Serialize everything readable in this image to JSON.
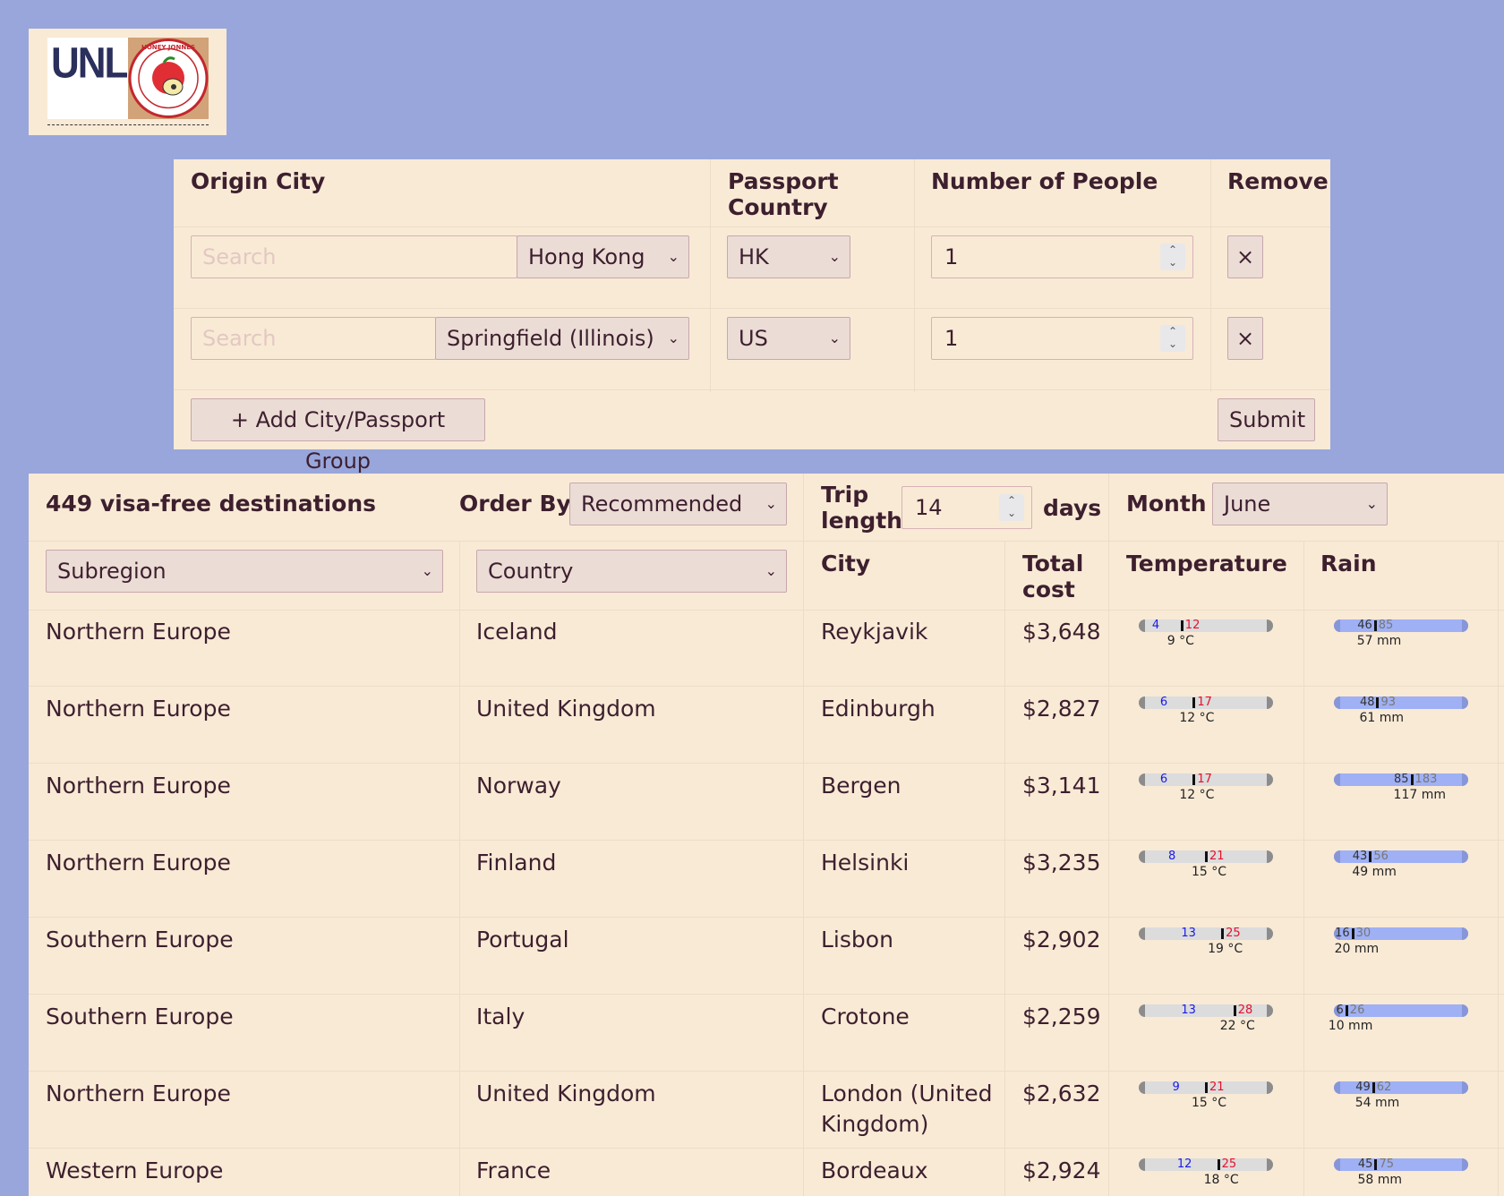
{
  "logo": {
    "text": "UNLI",
    "badge_text": "HONEY JONNES"
  },
  "form": {
    "headers": {
      "origin_city": "Origin City",
      "passport_country": "Passport Country",
      "num_people": "Number of People",
      "remove": "Remove"
    },
    "rows": [
      {
        "search_placeholder": "Search",
        "city": "Hong Kong",
        "passport": "HK",
        "people": "1",
        "remove_icon": "×"
      },
      {
        "search_placeholder": "Search",
        "city": "Springfield (Illinois)",
        "passport": "US",
        "people": "1",
        "remove_icon": "×"
      }
    ],
    "add_label": "+ Add City/Passport Group",
    "submit_label": "Submit"
  },
  "results": {
    "count_label": "449 visa-free destinations",
    "order_by_label": "Order By",
    "order_by_value": "Recommended",
    "trip_length_label": "Trip length",
    "trip_length_value": "14",
    "days_label": "days",
    "month_label": "Month",
    "month_value": "June",
    "filters": {
      "subregion": "Subregion",
      "country": "Country"
    },
    "columns": {
      "city": "City",
      "total_cost": "Total cost",
      "temperature": "Temperature",
      "rain": "Rain"
    },
    "rows": [
      {
        "subregion": "Northern Europe",
        "country": "Iceland",
        "city": "Reykjavik",
        "cost": "$3,648",
        "t_lo": "4",
        "t_hi": "12",
        "t_avg": "9 °C",
        "r_lo": "46",
        "r_hi": "85",
        "r_avg": "57 mm"
      },
      {
        "subregion": "Northern Europe",
        "country": "United Kingdom",
        "city": "Edinburgh",
        "cost": "$2,827",
        "t_lo": "6",
        "t_hi": "17",
        "t_avg": "12 °C",
        "r_lo": "48",
        "r_hi": "93",
        "r_avg": "61 mm"
      },
      {
        "subregion": "Northern Europe",
        "country": "Norway",
        "city": "Bergen",
        "cost": "$3,141",
        "t_lo": "6",
        "t_hi": "17",
        "t_avg": "12 °C",
        "r_lo": "85",
        "r_hi": "183",
        "r_avg": "117 mm"
      },
      {
        "subregion": "Northern Europe",
        "country": "Finland",
        "city": "Helsinki",
        "cost": "$3,235",
        "t_lo": "8",
        "t_hi": "21",
        "t_avg": "15 °C",
        "r_lo": "43",
        "r_hi": "56",
        "r_avg": "49 mm"
      },
      {
        "subregion": "Southern Europe",
        "country": "Portugal",
        "city": "Lisbon",
        "cost": "$2,902",
        "t_lo": "13",
        "t_hi": "25",
        "t_avg": "19 °C",
        "r_lo": "16",
        "r_hi": "30",
        "r_avg": "20 mm"
      },
      {
        "subregion": "Southern Europe",
        "country": "Italy",
        "city": "Crotone",
        "cost": "$2,259",
        "t_lo": "13",
        "t_hi": "28",
        "t_avg": "22 °C",
        "r_lo": "6",
        "r_hi": "26",
        "r_avg": "10 mm"
      },
      {
        "subregion": "Northern Europe",
        "country": "United Kingdom",
        "city": "London (United Kingdom)",
        "cost": "$2,632",
        "t_lo": "9",
        "t_hi": "21",
        "t_avg": "15 °C",
        "r_lo": "49",
        "r_hi": "62",
        "r_avg": "54 mm"
      },
      {
        "subregion": "Western Europe",
        "country": "France",
        "city": "Bordeaux",
        "cost": "$2,924",
        "t_lo": "12",
        "t_hi": "25",
        "t_avg": "18 °C",
        "r_lo": "45",
        "r_hi": "75",
        "r_avg": "58 mm"
      }
    ]
  }
}
